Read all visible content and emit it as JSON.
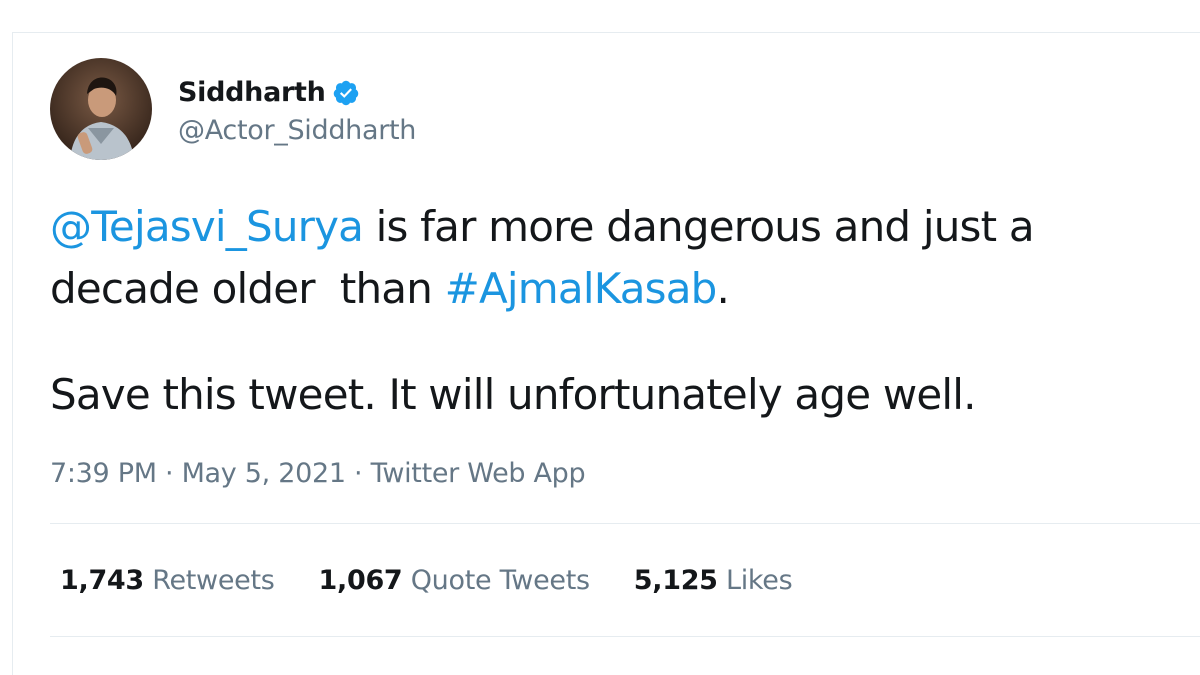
{
  "tweet": {
    "author": {
      "display_name": "Siddharth",
      "handle": "@Actor_Siddharth",
      "verified": true,
      "avatar_icon": "profile-photo-icon"
    },
    "text": {
      "line1_mention": "@Tejasvi_Surya",
      "line1_rest": " is far more dangerous and just a",
      "line2_start": "decade older  than ",
      "line2_hashtag": "#AjmalKasab",
      "line2_end": ".",
      "paragraph2": "Save this tweet. It will unfortunately age well."
    },
    "meta": {
      "time": "7:39 PM",
      "sep1": " · ",
      "date": "May 5, 2021",
      "sep2": " · ",
      "source": "Twitter Web App"
    },
    "stats": {
      "retweets_count": "1,743",
      "retweets_label": "Retweets",
      "quote_count": "1,067",
      "quote_label": "Quote Tweets",
      "likes_count": "5,125",
      "likes_label": "Likes"
    }
  },
  "colors": {
    "link": "#1b95e0",
    "secondary_text": "#657786",
    "primary_text": "#14171a",
    "divider": "#e6ecf0",
    "verified_badge": "#1da1f2"
  }
}
